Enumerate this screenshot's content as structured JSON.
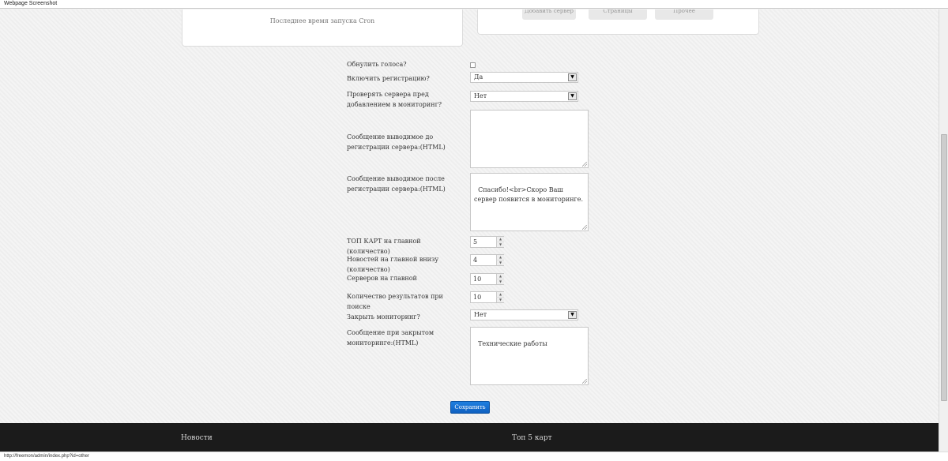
{
  "window": {
    "title": "Webpage Screenshot"
  },
  "top_panels": {
    "cron_label": "Последнее время запуска Cron",
    "ghost_buttons": [
      "Добавить сервер",
      "Страницы",
      "Прочее"
    ]
  },
  "form": {
    "reset_votes": {
      "label": "Обнулить голоса?",
      "checked": false
    },
    "enable_registration": {
      "label": "Включить регистрацию?",
      "value": "Да"
    },
    "check_servers": {
      "label": "Проверять сервера пред добавлением в мониторинг?",
      "value": "Нет"
    },
    "msg_before_reg": {
      "label": "Сообщение выводимое до регистрации сервера:(HTML)",
      "value": ""
    },
    "msg_after_reg": {
      "label": "Сообщение выводимое после регистрации сервера:(HTML)",
      "value": "Спасибо!<br>Скоро Ваш сервер появится в мониторинге."
    },
    "top_maps": {
      "label": "ТОП КАРТ на главной (количество)",
      "value": "5"
    },
    "news_main": {
      "label": "Новостей на главной внизу (количество)",
      "value": "4"
    },
    "servers_main": {
      "label": "Серверов на главной",
      "value": "10"
    },
    "search_results": {
      "label": "Количество результатов при поиске",
      "value": "10"
    },
    "close_monitoring": {
      "label": "Закрыть мониторинг?",
      "value": "Нет"
    },
    "closed_msg": {
      "label": "Сообщение при закрытом мониторинге:(HTML)",
      "value": "Технические работы"
    },
    "save_label": "Сохранить"
  },
  "footer": {
    "news": "Новости",
    "top5": "Топ 5 карт"
  },
  "status_url": "http://freemon/admin/index.php?id=other",
  "icons": {
    "select_arrow": "chevron-down-icon",
    "spin_up": "arrow-up-icon",
    "spin_down": "arrow-down-icon"
  },
  "colors": {
    "primary_button": "#1670d0",
    "footer_bg": "#1b1b1b"
  }
}
